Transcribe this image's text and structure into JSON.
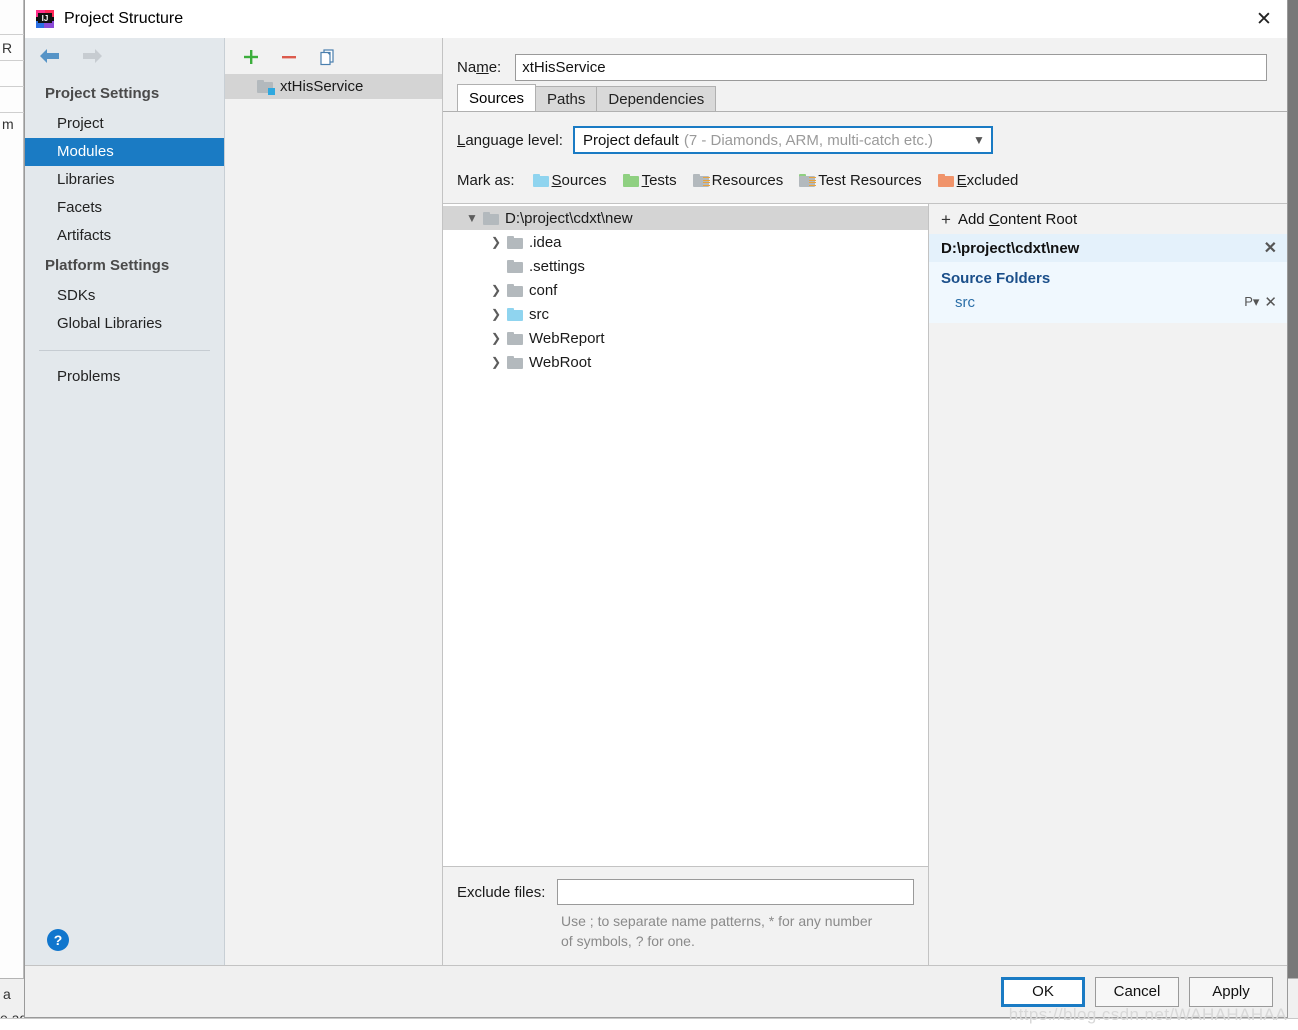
{
  "backdrop": {
    "fragment_top": "R",
    "fragment_mid": "m",
    "fragment_bottom1": "a",
    "fragment_bottom2": "e ago)"
  },
  "window": {
    "title": "Project Structure",
    "app_icon": "intellij-idea-icon",
    "close_icon": "close-icon"
  },
  "sidebar": {
    "back_icon": "back-arrow-icon",
    "forward_icon": "forward-arrow-icon",
    "groups": [
      {
        "heading": "Project Settings",
        "items": [
          {
            "label": "Project",
            "selected": false
          },
          {
            "label": "Modules",
            "selected": true
          },
          {
            "label": "Libraries",
            "selected": false
          },
          {
            "label": "Facets",
            "selected": false
          },
          {
            "label": "Artifacts",
            "selected": false
          }
        ]
      },
      {
        "heading": "Platform Settings",
        "items": [
          {
            "label": "SDKs",
            "selected": false
          },
          {
            "label": "Global Libraries",
            "selected": false
          }
        ]
      }
    ],
    "problems_label": "Problems",
    "help_label": "?"
  },
  "modules_panel": {
    "toolbar": {
      "add_icon": "plus-icon",
      "remove_icon": "minus-icon",
      "copy_icon": "copy-icon"
    },
    "items": [
      {
        "label": "xtHisService",
        "icon": "module-folder-icon",
        "selected": true
      }
    ]
  },
  "main": {
    "name_label": "Name:",
    "name_value": "xtHisService",
    "name_placeholder": "",
    "tabs": [
      {
        "label": "Sources",
        "active": true
      },
      {
        "label": "Paths",
        "active": false
      },
      {
        "label": "Dependencies",
        "active": false
      }
    ],
    "language_level": {
      "label": "Language level:",
      "selected": "Project default",
      "hint": "(7 - Diamonds, ARM, multi-catch etc.)",
      "caret_icon": "chevron-down-icon"
    },
    "mark_as": {
      "label": "Mark as:",
      "options": [
        {
          "label": "Sources",
          "icon": "sources-folder-icon",
          "color": "#8fd4ef"
        },
        {
          "label": "Tests",
          "icon": "tests-folder-icon",
          "color": "#8fd081"
        },
        {
          "label": "Resources",
          "icon": "resources-folder-icon",
          "color": "#b3b9bd"
        },
        {
          "label": "Test Resources",
          "icon": "test-resources-folder-icon",
          "color": "#b3b9bd"
        },
        {
          "label": "Excluded",
          "icon": "excluded-folder-icon",
          "color": "#f0936a"
        }
      ]
    },
    "tree": [
      {
        "label": "D:\\project\\cdxt\\new",
        "depth": 0,
        "expanded": true,
        "has_children": true,
        "selected": true,
        "color": "#b3b9bd"
      },
      {
        "label": ".idea",
        "depth": 1,
        "expanded": false,
        "has_children": true,
        "selected": false,
        "color": "#b3b9bd"
      },
      {
        "label": ".settings",
        "depth": 1,
        "expanded": false,
        "has_children": false,
        "selected": false,
        "color": "#b3b9bd"
      },
      {
        "label": "conf",
        "depth": 1,
        "expanded": false,
        "has_children": true,
        "selected": false,
        "color": "#b3b9bd"
      },
      {
        "label": "src",
        "depth": 1,
        "expanded": false,
        "has_children": true,
        "selected": false,
        "color": "#8fd4ef"
      },
      {
        "label": "WebReport",
        "depth": 1,
        "expanded": false,
        "has_children": true,
        "selected": false,
        "color": "#b3b9bd"
      },
      {
        "label": "WebRoot",
        "depth": 1,
        "expanded": false,
        "has_children": true,
        "selected": false,
        "color": "#b3b9bd"
      }
    ],
    "exclude": {
      "label": "Exclude files:",
      "value": "",
      "placeholder": "",
      "hint": "Use ; to separate name patterns, * for any number of symbols, ? for one."
    }
  },
  "details": {
    "add_content_root": "Add Content Root",
    "add_icon": "plus-icon",
    "content_root": "D:\\project\\cdxt\\new",
    "content_root_remove_icon": "close-icon",
    "source_folders_title": "Source Folders",
    "source_folders": [
      {
        "label": "src",
        "package_prefix_icon": "package-prefix-icon",
        "remove_icon": "close-icon"
      }
    ]
  },
  "footer": {
    "buttons": [
      {
        "label": "OK",
        "default": true
      },
      {
        "label": "Cancel",
        "default": false
      },
      {
        "label": "Apply",
        "default": false
      }
    ],
    "watermark": "https://blog.csdn.net/WAHAHAHAA"
  },
  "colors": {
    "accent": "#1a7bc4",
    "sidebar_bg": "#e3e8ec",
    "selection": "#1a7bc4",
    "panel_bg": "#f2f2f2",
    "details_highlight": "#e4f1fb"
  }
}
